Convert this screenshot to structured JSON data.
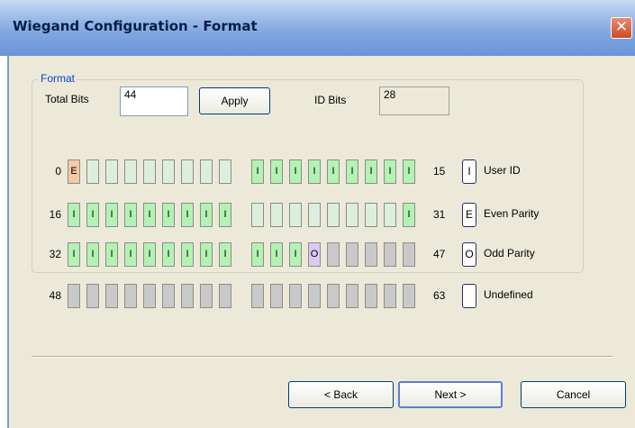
{
  "window": {
    "title": "Wiegand Configuration - Format",
    "close_glyph": "✕"
  },
  "form": {
    "total_bits_label": "Total Bits",
    "total_bits_value": "44",
    "apply_label": "Apply",
    "id_bits_label": "ID Bits",
    "id_bits_value": "28"
  },
  "format_group": {
    "legend": "Format",
    "rows": [
      {
        "start": "0",
        "end": "15",
        "left": [
          "E",
          "",
          "",
          "",
          "",
          "",
          "",
          "",
          ""
        ],
        "left_types": [
          "even",
          "blank",
          "blank",
          "blank",
          "blank",
          "blank",
          "blank",
          "blank",
          "blank"
        ],
        "right": [
          "I",
          "I",
          "I",
          "I",
          "I",
          "I",
          "I",
          "I",
          "I"
        ],
        "right_types": [
          "user",
          "user",
          "user",
          "user",
          "user",
          "user",
          "user",
          "user",
          "user"
        ]
      },
      {
        "start": "16",
        "end": "31",
        "left": [
          "I",
          "I",
          "I",
          "I",
          "I",
          "I",
          "I",
          "I",
          "I"
        ],
        "left_types": [
          "user",
          "user",
          "user",
          "user",
          "user",
          "user",
          "user",
          "user",
          "user"
        ],
        "right": [
          "",
          "",
          "",
          "",
          "",
          "",
          "",
          "",
          "I"
        ],
        "right_types": [
          "blank",
          "blank",
          "blank",
          "blank",
          "blank",
          "blank",
          "blank",
          "blank",
          "user"
        ]
      },
      {
        "start": "32",
        "end": "47",
        "left": [
          "I",
          "I",
          "I",
          "I",
          "I",
          "I",
          "I",
          "I",
          "I"
        ],
        "left_types": [
          "user",
          "user",
          "user",
          "user",
          "user",
          "user",
          "user",
          "user",
          "user"
        ],
        "right": [
          "I",
          "I",
          "I",
          "O",
          "",
          "",
          "",
          "",
          ""
        ],
        "right_types": [
          "user",
          "user",
          "user",
          "odd",
          "undef",
          "undef",
          "undef",
          "undef",
          "undef"
        ]
      },
      {
        "start": "48",
        "end": "63",
        "left": [
          "",
          "",
          "",
          "",
          "",
          "",
          "",
          "",
          ""
        ],
        "left_types": [
          "undef",
          "undef",
          "undef",
          "undef",
          "undef",
          "undef",
          "undef",
          "undef",
          "undef"
        ],
        "right": [
          "",
          "",
          "",
          "",
          "",
          "",
          "",
          "",
          ""
        ],
        "right_types": [
          "undef",
          "undef",
          "undef",
          "undef",
          "undef",
          "undef",
          "undef",
          "undef",
          "undef"
        ]
      }
    ],
    "legend_items": [
      {
        "code": "I",
        "label": "User ID"
      },
      {
        "code": "E",
        "label": "Even Parity"
      },
      {
        "code": "O",
        "label": "Odd Parity"
      },
      {
        "code": "",
        "label": "Undefined"
      }
    ]
  },
  "buttons": {
    "back": "< Back",
    "next": "Next >",
    "cancel": "Cancel"
  },
  "colors": {
    "user_id": "#b3f2b3",
    "even_parity": "#f5c8a6",
    "odd_parity": "#dcc8f0",
    "undefined": "#c9c9c9"
  }
}
